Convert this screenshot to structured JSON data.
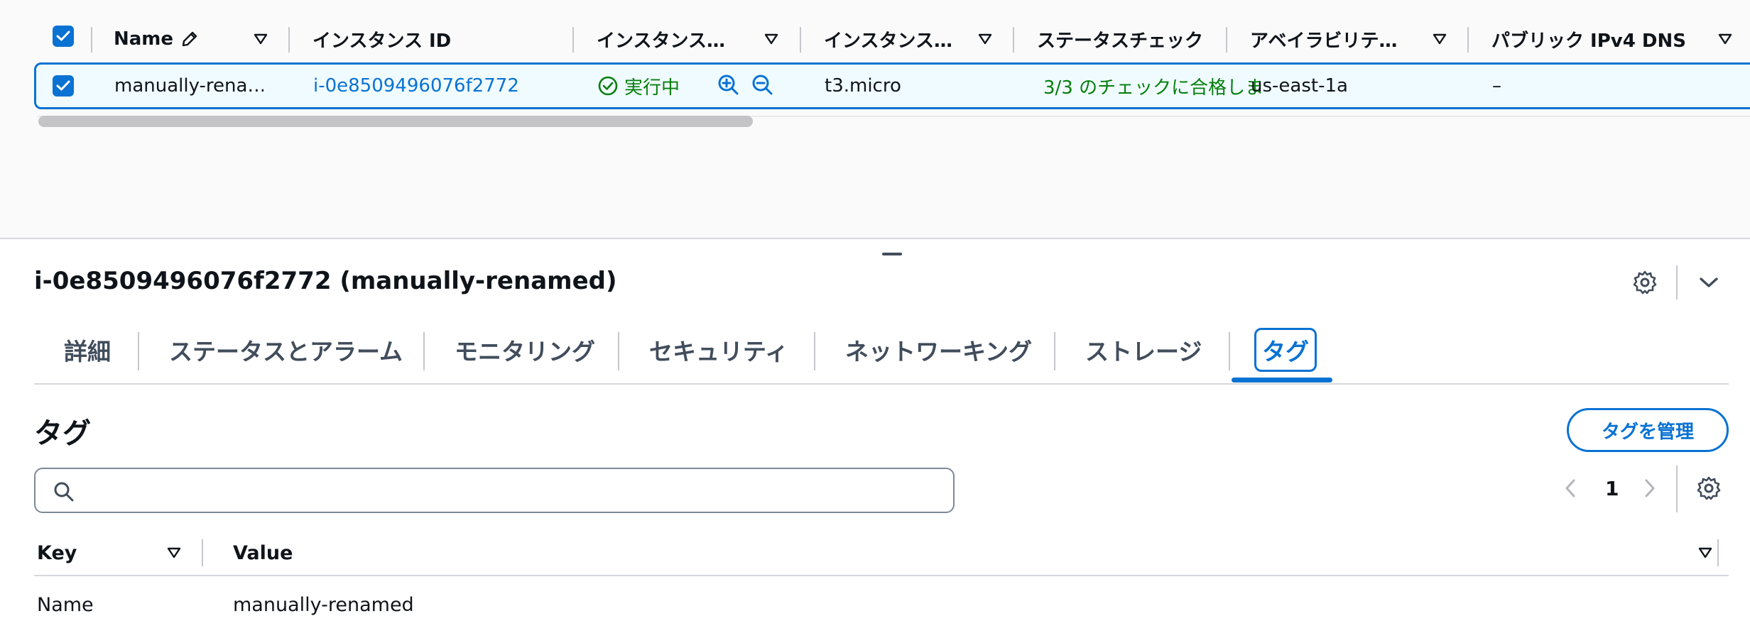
{
  "instance_table": {
    "columns": [
      {
        "label": "Name",
        "editable": true
      },
      {
        "label": "インスタンス ID"
      },
      {
        "label": "インスタンス…"
      },
      {
        "label": "インスタンス…"
      },
      {
        "label": "ステータスチェック"
      },
      {
        "label": "アベイラビリテ…"
      },
      {
        "label": "パブリック IPv4 DNS"
      }
    ],
    "row": {
      "name": "manually-rena…",
      "instance_id": "i-0e8509496076f2772",
      "state": "実行中",
      "instance_type": "t3.micro",
      "status_check": "3/3 のチェックに合格しました",
      "availability_zone": "us-east-1a",
      "public_dns": "–",
      "selected": true
    }
  },
  "details": {
    "title": "i-0e8509496076f2772 (manually-renamed)",
    "tabs": [
      "詳細",
      "ステータスとアラーム",
      "モニタリング",
      "セキュリティ",
      "ネットワーキング",
      "ストレージ",
      "タグ"
    ],
    "active_tab": "タグ",
    "tags_section": {
      "title": "タグ",
      "manage_button": "タグを管理",
      "search_placeholder": "",
      "page": "1",
      "columns": [
        "Key",
        "Value"
      ],
      "rows": [
        {
          "key": "Name",
          "value": "manually-renamed"
        }
      ]
    }
  },
  "colors": {
    "accent": "#0972d3",
    "success": "#037f0c",
    "selected_row_bg": "#f0fbff"
  }
}
